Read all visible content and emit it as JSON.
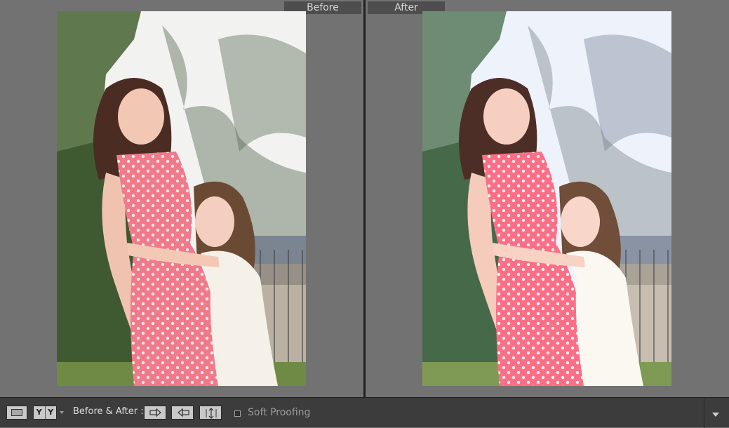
{
  "panes": {
    "before_label": "Before",
    "after_label": "After"
  },
  "photos": {
    "before": {
      "description_icon": "photo-mother-daughter",
      "tint": "#e8e8e8",
      "dress_color": "#f07a8a",
      "dress_accent": "#e26473",
      "sky": "#f2f2f0",
      "foliage": "#4f6a3c"
    },
    "after": {
      "description_icon": "photo-mother-daughter",
      "tint": "#f4f6ff",
      "dress_color": "#fb6f86",
      "dress_accent": "#ef5b77",
      "sky": "#eef2fb",
      "foliage": "#57795a"
    }
  },
  "toolbar": {
    "view_yy": [
      "Y",
      "Y"
    ],
    "before_after_label": "Before & After :",
    "soft_proofing_label": "Soft Proofing",
    "soft_proofing_checked": false
  }
}
